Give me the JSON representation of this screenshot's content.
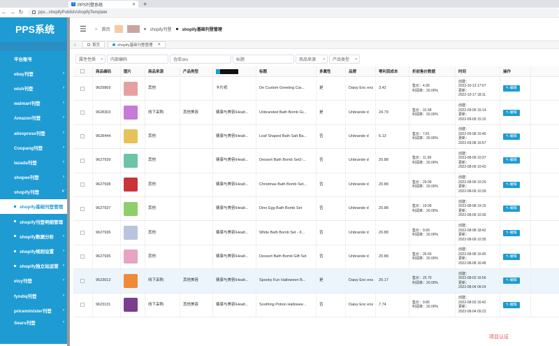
{
  "browser": {
    "tab_title": "PPS刊登系统",
    "url": "pps...shopifyPublish/shopifyTemplate"
  },
  "sidebar": {
    "logo": "PPS系统",
    "items": [
      {
        "label": "平台账号"
      },
      {
        "label": "ebay刊登"
      },
      {
        "label": "wish刊登"
      },
      {
        "label": "walmart刊登"
      },
      {
        "label": "Amazon刊登"
      },
      {
        "label": "aliexpress刊登"
      },
      {
        "label": "Coupang刊登"
      },
      {
        "label": "lazada刊登"
      },
      {
        "label": "shopee刊登"
      },
      {
        "label": "shopify刊登"
      },
      {
        "label": "shopify基础刊登管理"
      },
      {
        "label": "shopify刊登明细管理"
      },
      {
        "label": "shopify数据分析"
      },
      {
        "label": "shopify规则设置"
      },
      {
        "label": "shopify独立站运营"
      },
      {
        "label": "etsy刊登"
      },
      {
        "label": "fyndiq刊登"
      },
      {
        "label": "priceminister刊登"
      },
      {
        "label": "Sears刊登"
      }
    ]
  },
  "header": {
    "home": "首页",
    "crumb1": "shopify刊登",
    "crumb2": "shopify基础刊登管理"
  },
  "page_tabs": {
    "home": "首页",
    "active": "shopify基础刊登管理"
  },
  "filters": {
    "attr": "属性性质",
    "code": "内部编码",
    "sku": "仓库sku",
    "title": "标题",
    "source": "商品来源",
    "ptype": "产品类型"
  },
  "table": {
    "headers": {
      "code": "商品编码",
      "img": "图片",
      "src": "商品来源",
      "type": "产品类型",
      "title": "标题",
      "multi": "多属性",
      "brand": "品牌",
      "cost": "零利润成本",
      "disc": "折前售价数据",
      "time": "时间",
      "op": "操作"
    },
    "rows": [
      {
        "code": "9629869",
        "src": "其他",
        "type": "",
        "cat": "卡片纸",
        "title": "De Custom Greeting Car...",
        "multi": "是",
        "brand": "Daisy Enc ens",
        "cost": "3.42",
        "price": "售价：4.36",
        "profit": "利润率：20.00%",
        "created": "创建：",
        "cdate": "2022-10-13 17:57",
        "updated": "更新：",
        "udate": "2022-10-17 18:11",
        "edit": "编辑",
        "color": "#e6a0a0"
      },
      {
        "code": "9628303",
        "src": "线下采购",
        "type": "其他美容",
        "cat": "健康与美容\\Healt...",
        "title": "Unbranded Bath Bomb Gi...",
        "multi": "是",
        "brand": "Unbrande d",
        "cost": "24.79",
        "price": "售价：31.58",
        "profit": "利润率：20.00%",
        "created": "创建：",
        "cdate": "2022-09-09 15:14",
        "updated": "更新：",
        "udate": "2022-09-09 15:15",
        "edit": "编辑",
        "color": "#c77ad6"
      },
      {
        "code": "9628444",
        "src": "其他",
        "type": "",
        "cat": "健康与美容\\Healt...",
        "title": "Leaf Shaped Bath Salt Ba...",
        "multi": "否",
        "brand": "Unbrande d",
        "cost": "6.13",
        "price": "售价：7.81",
        "profit": "利润率：20.00%",
        "created": "创建：",
        "cdate": "2022-09-08 15:46",
        "updated": "更新：",
        "udate": "2022-09-08 16:57",
        "edit": "编辑",
        "color": "#e5c35a"
      },
      {
        "code": "9627939",
        "src": "其他",
        "type": "",
        "cat": "健康与美容\\Healt...",
        "title": "Dessert Bath Bomb Set2-...",
        "multi": "否",
        "brand": "Unbrande d",
        "cost": "20.88",
        "price": "售价：11.99",
        "profit": "利润率：20.00%",
        "created": "创建：",
        "cdate": "2022-08-09 10:37",
        "updated": "更新：",
        "udate": "2022-08-09 10:43",
        "edit": "编辑",
        "color": "#6bc4a8"
      },
      {
        "code": "9627938",
        "src": "其他",
        "type": "",
        "cat": "健康与美容\\Healt...",
        "title": "Christmas Bath Bomb Set...",
        "multi": "否",
        "brand": "Unbrande d",
        "cost": "20.88",
        "price": "售价：29.99",
        "profit": "利润率：20.00%",
        "created": "创建：",
        "cdate": "2022-08-09 10:29",
        "updated": "更新：",
        "udate": "2022-08-09 10:39",
        "edit": "编辑",
        "color": "#c8343a"
      },
      {
        "code": "9627937",
        "src": "其他",
        "type": "",
        "cat": "健康与美容\\Healt...",
        "title": "Dino Egg Bath Bomb Set",
        "multi": "否",
        "brand": "Unbrande d",
        "cost": "20.88",
        "price": "售价：19.99",
        "profit": "利润率：20.00%",
        "created": "创建：",
        "cdate": "2022-08-08 19:15",
        "updated": "更新：",
        "udate": "2022-08-09 10:36",
        "edit": "编辑",
        "color": "#8fcf6a"
      },
      {
        "code": "9627936",
        "src": "其他",
        "type": "",
        "cat": "健康与美容\\Healt...",
        "title": "White Bath Bomb Set - 6...",
        "multi": "否",
        "brand": "Unbrande d",
        "cost": "20.88",
        "price": "售价：9.99",
        "profit": "利润率：20.00%",
        "created": "创建：",
        "cdate": "2022-08-08 18:42",
        "updated": "更新：",
        "udate": "2022-08-09 10:35",
        "edit": "编辑",
        "color": "#b9c4de"
      },
      {
        "code": "9627935",
        "src": "其他",
        "type": "",
        "cat": "健康与美容\\Healt...",
        "title": "Dessert Bath Bomb Gift Set",
        "multi": "否",
        "brand": "Unbrande d",
        "cost": "20.88",
        "price": "售价：26.60",
        "profit": "利润率：20.00%",
        "created": "创建：",
        "cdate": "2022-08-08 16:45",
        "updated": "更新：",
        "udate": "2022-08-08 16:48",
        "edit": "编辑",
        "color": "#e8a2c2"
      },
      {
        "code": "9623013",
        "src": "线下采购",
        "type": "其他美容",
        "cat": "健康与美容\\Healt...",
        "title": "Spooky Fun Halloween B...",
        "multi": "是",
        "brand": "Daisy Enc ens",
        "cost": "20.17",
        "price": "售价：25.70",
        "profit": "利润率：20.00%",
        "created": "创建：",
        "cdate": "2022-08-03 16:56",
        "updated": "更新：",
        "udate": "2022-08-04 09:24",
        "edit": "编辑",
        "color": "#ee8a3a"
      },
      {
        "code": "9623131",
        "src": "线下采购",
        "type": "其他美容",
        "cat": "健康与美容\\Healt...",
        "title": "Soothing Potion Hallowee...",
        "multi": "否",
        "brand": "Daisy Enc ens",
        "cost": "7.74",
        "price": "售价：9.86",
        "profit": "利润率：20.00%",
        "created": "创建：",
        "cdate": "2022-08-03 16:42",
        "updated": "更新：",
        "udate": "2022-08-04 09:23",
        "edit": "编辑",
        "color": "#7a3d8f"
      }
    ]
  },
  "watermark": "项目认证"
}
